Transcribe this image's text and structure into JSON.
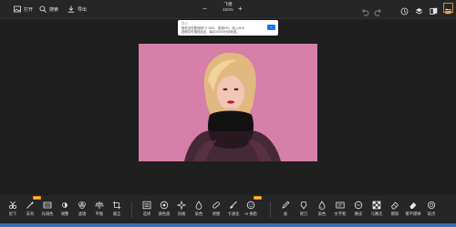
{
  "topbar": {
    "open_label": "打开",
    "search_label": "搜索",
    "save_label": "导出",
    "title": "飞猪",
    "zoom": "100%",
    "zoom_out": "−",
    "zoom_in": "+"
  },
  "tooltip": {
    "title": "提示",
    "line1": "降低实时看视频TO SDK、视频API、接入SDK",
    "line2": "视频实时播放延迟，每月10000分钟免费。",
    "button": "↑"
  },
  "tools_left": [
    {
      "name": "undo-tool",
      "label": "剪下",
      "icon": "scissors"
    },
    {
      "name": "clear-tool",
      "label": "去背",
      "icon": "magic",
      "badge": "NEW"
    },
    {
      "name": "redraw-tool",
      "label": "光调色",
      "icon": "sliders"
    },
    {
      "name": "pen-tool",
      "label": "调整",
      "icon": "sun"
    },
    {
      "name": "filter-tool",
      "label": "滤镜",
      "icon": "circles"
    },
    {
      "name": "balance-tool",
      "label": "平衡",
      "icon": "scale"
    },
    {
      "name": "crop-tool",
      "label": "裁正",
      "icon": "crop"
    }
  ],
  "tools_mid": [
    {
      "name": "select-tool",
      "label": "选择",
      "icon": "list"
    },
    {
      "name": "adjust-tool",
      "label": "调色盘",
      "icon": "palette"
    },
    {
      "name": "style-tool",
      "label": "风格",
      "icon": "sparkle"
    },
    {
      "name": "color-tool",
      "label": "染色",
      "icon": "drop"
    },
    {
      "name": "slider-tool",
      "label": "修图",
      "icon": "bandaid"
    },
    {
      "name": "rotate-tool",
      "label": "卡通化",
      "icon": "brush"
    },
    {
      "name": "ai-tool",
      "label": "AI 换脸",
      "icon": "face",
      "badge": "NEW"
    }
  ],
  "tools_right": [
    {
      "name": "pen2-tool",
      "label": "画",
      "icon": "pencil"
    },
    {
      "name": "eraser-tool",
      "label": "修刀",
      "icon": "sculpt"
    },
    {
      "name": "ink-tool",
      "label": "染色",
      "icon": "drop2"
    },
    {
      "name": "text-tool",
      "label": "文字框",
      "icon": "textbox"
    },
    {
      "name": "clear-bg-tool",
      "label": "橡皮",
      "icon": "eraser"
    },
    {
      "name": "mosaic-tool",
      "label": "马赛克",
      "icon": "mosaic"
    },
    {
      "name": "erase-tool",
      "label": "擦除",
      "icon": "erase"
    },
    {
      "name": "erase2-tool",
      "label": "擦不擦掉",
      "icon": "erase2"
    },
    {
      "name": "spot-tool",
      "label": "斑点",
      "icon": "spot"
    }
  ],
  "colors": {
    "accent": "#1677ff",
    "badge": "#f08a00",
    "canvas": "#d67fa9"
  }
}
